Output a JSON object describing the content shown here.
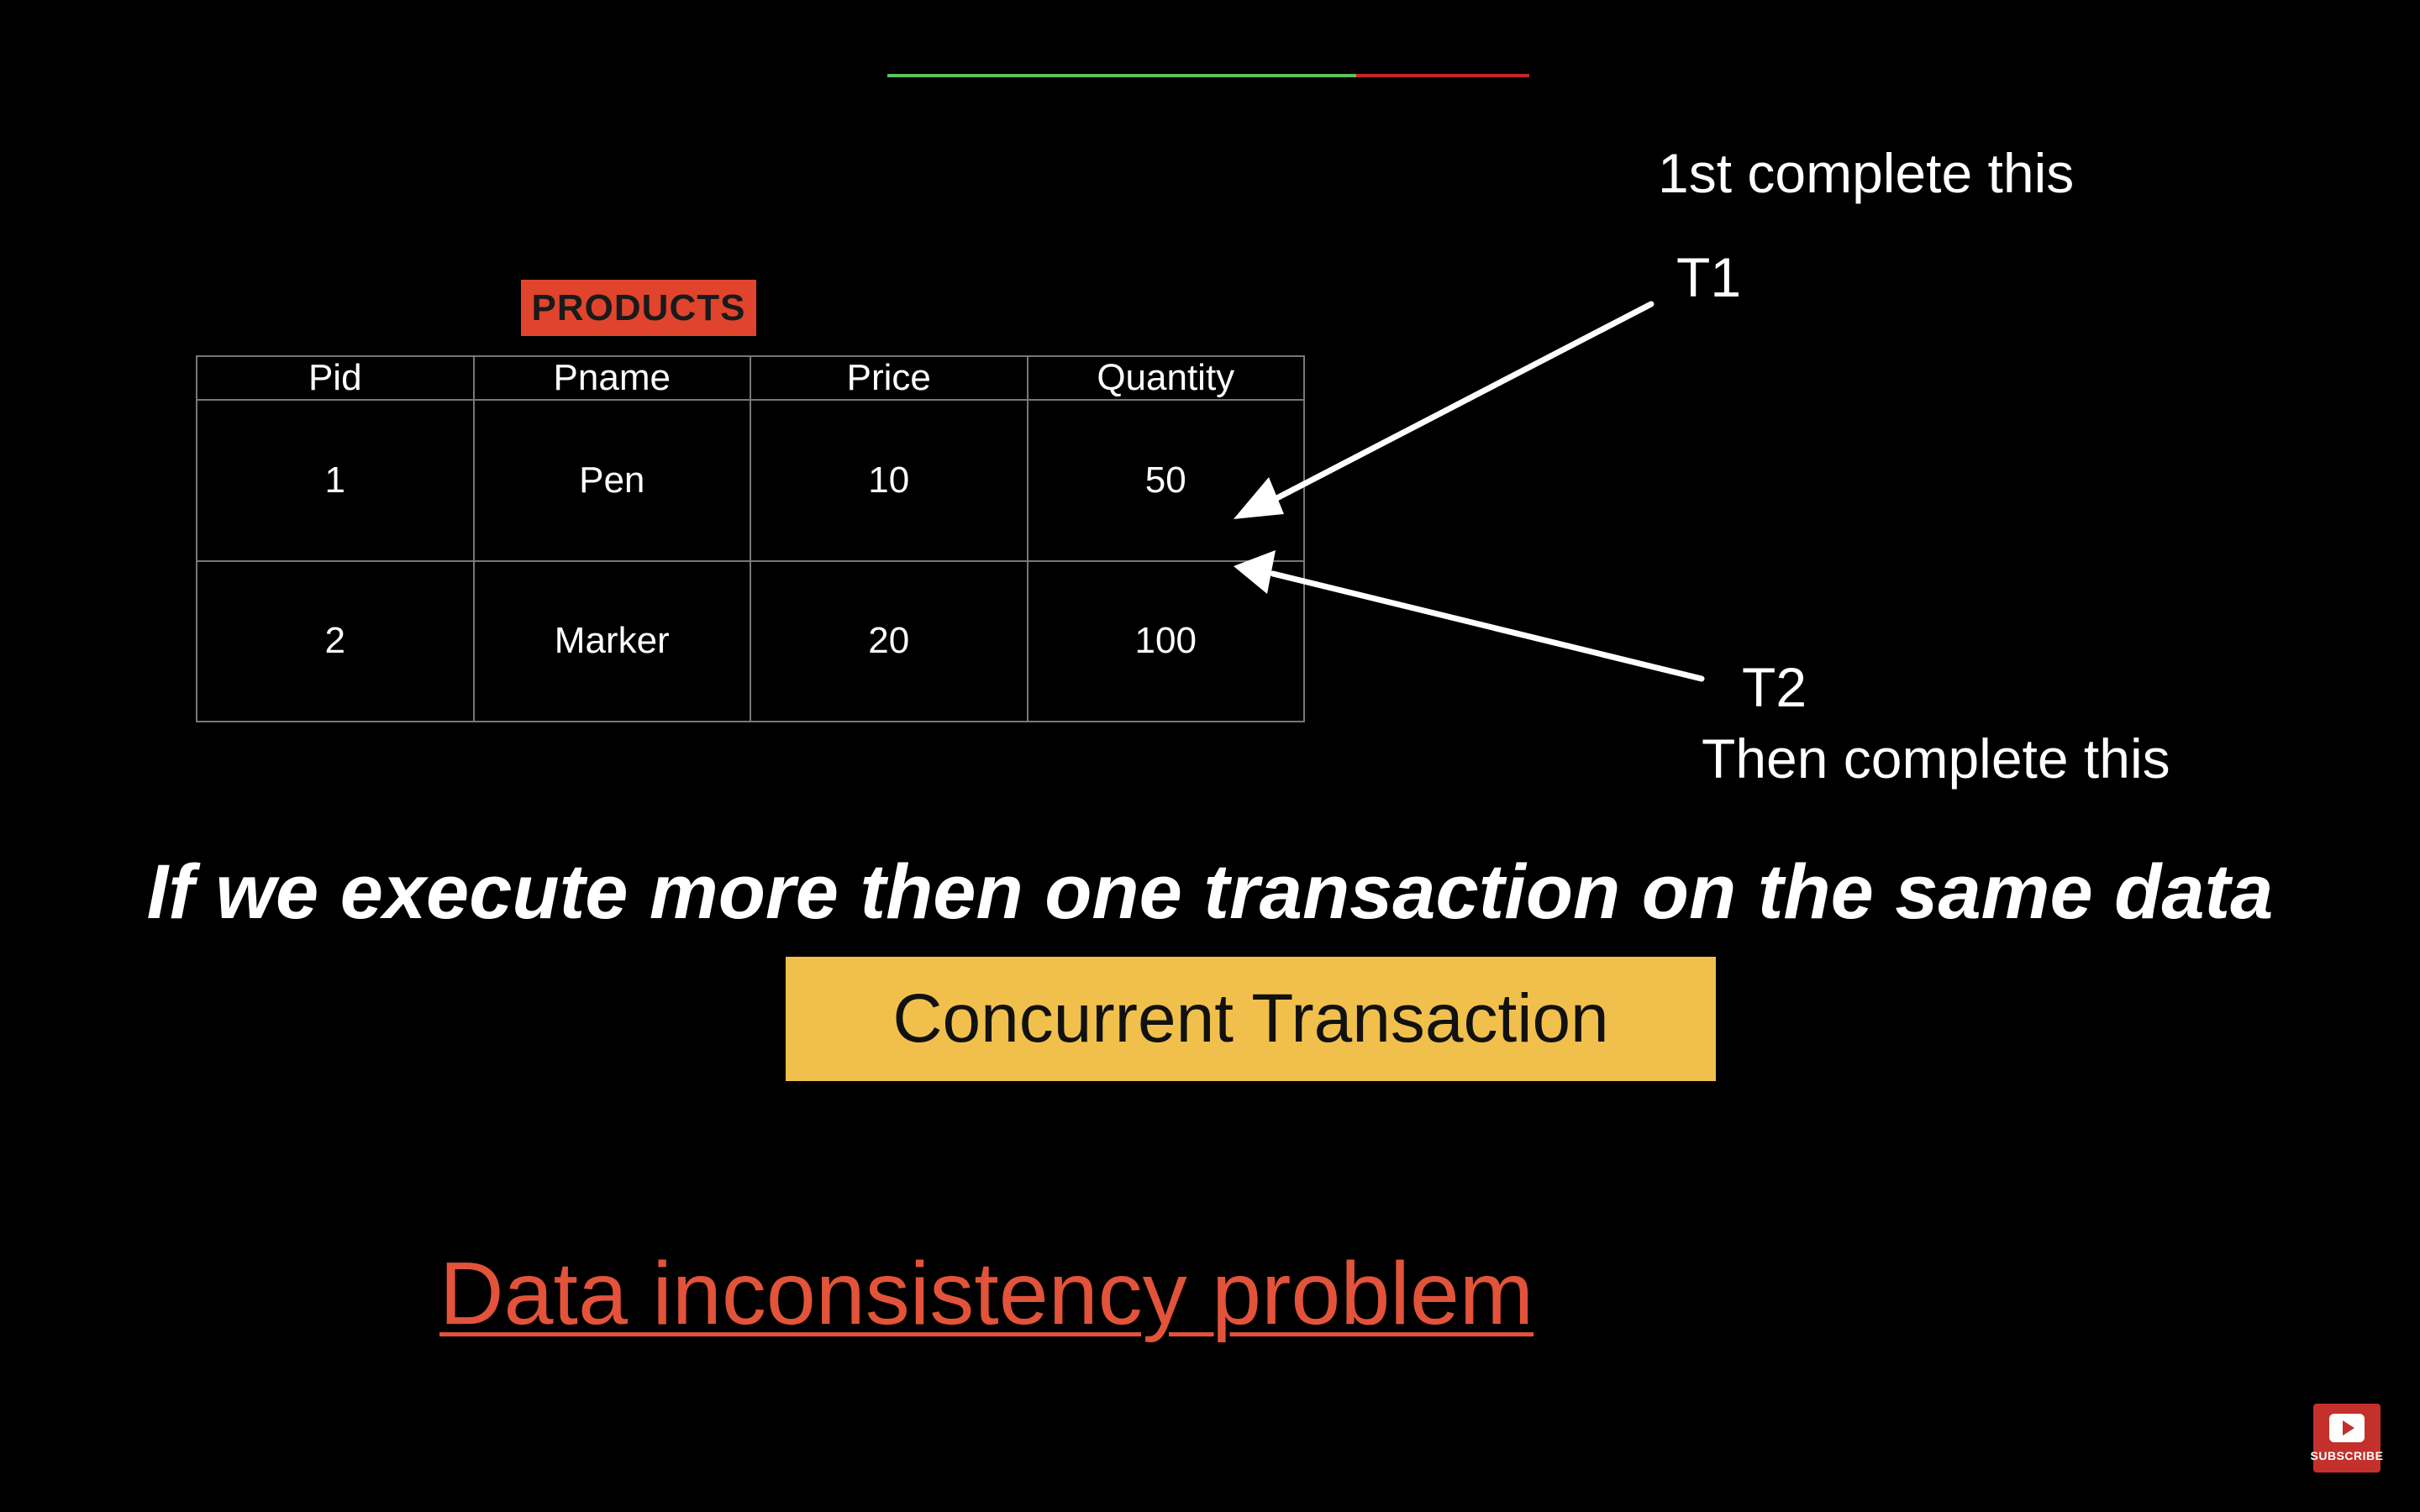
{
  "video": {
    "progress_fraction": 0.73
  },
  "slide": {
    "table_label": "PRODUCTS",
    "table": {
      "headers": [
        "Pid",
        "Pname",
        "Price",
        "Quantity"
      ],
      "rows": [
        [
          "1",
          "Pen",
          "10",
          "50"
        ],
        [
          "2",
          "Marker",
          "20",
          "100"
        ]
      ]
    },
    "annotations": {
      "t1_note": "1st complete this",
      "t1_label": "T1",
      "t2_label": "T2",
      "t2_note": "Then complete this"
    },
    "headline": "If we execute more then one transaction on the same data",
    "concept": "Concurrent Transaction",
    "problem": "Data inconsistency problem"
  },
  "subscribe": {
    "label": "SUBSCRIBE"
  },
  "colors": {
    "progress_played": "#5ec45e",
    "progress_remaining": "#c62828",
    "label_red": "#e0442d",
    "concept_yellow": "#f1c04c",
    "problem_red": "#e2533a",
    "subscribe_red": "#c4302b"
  }
}
